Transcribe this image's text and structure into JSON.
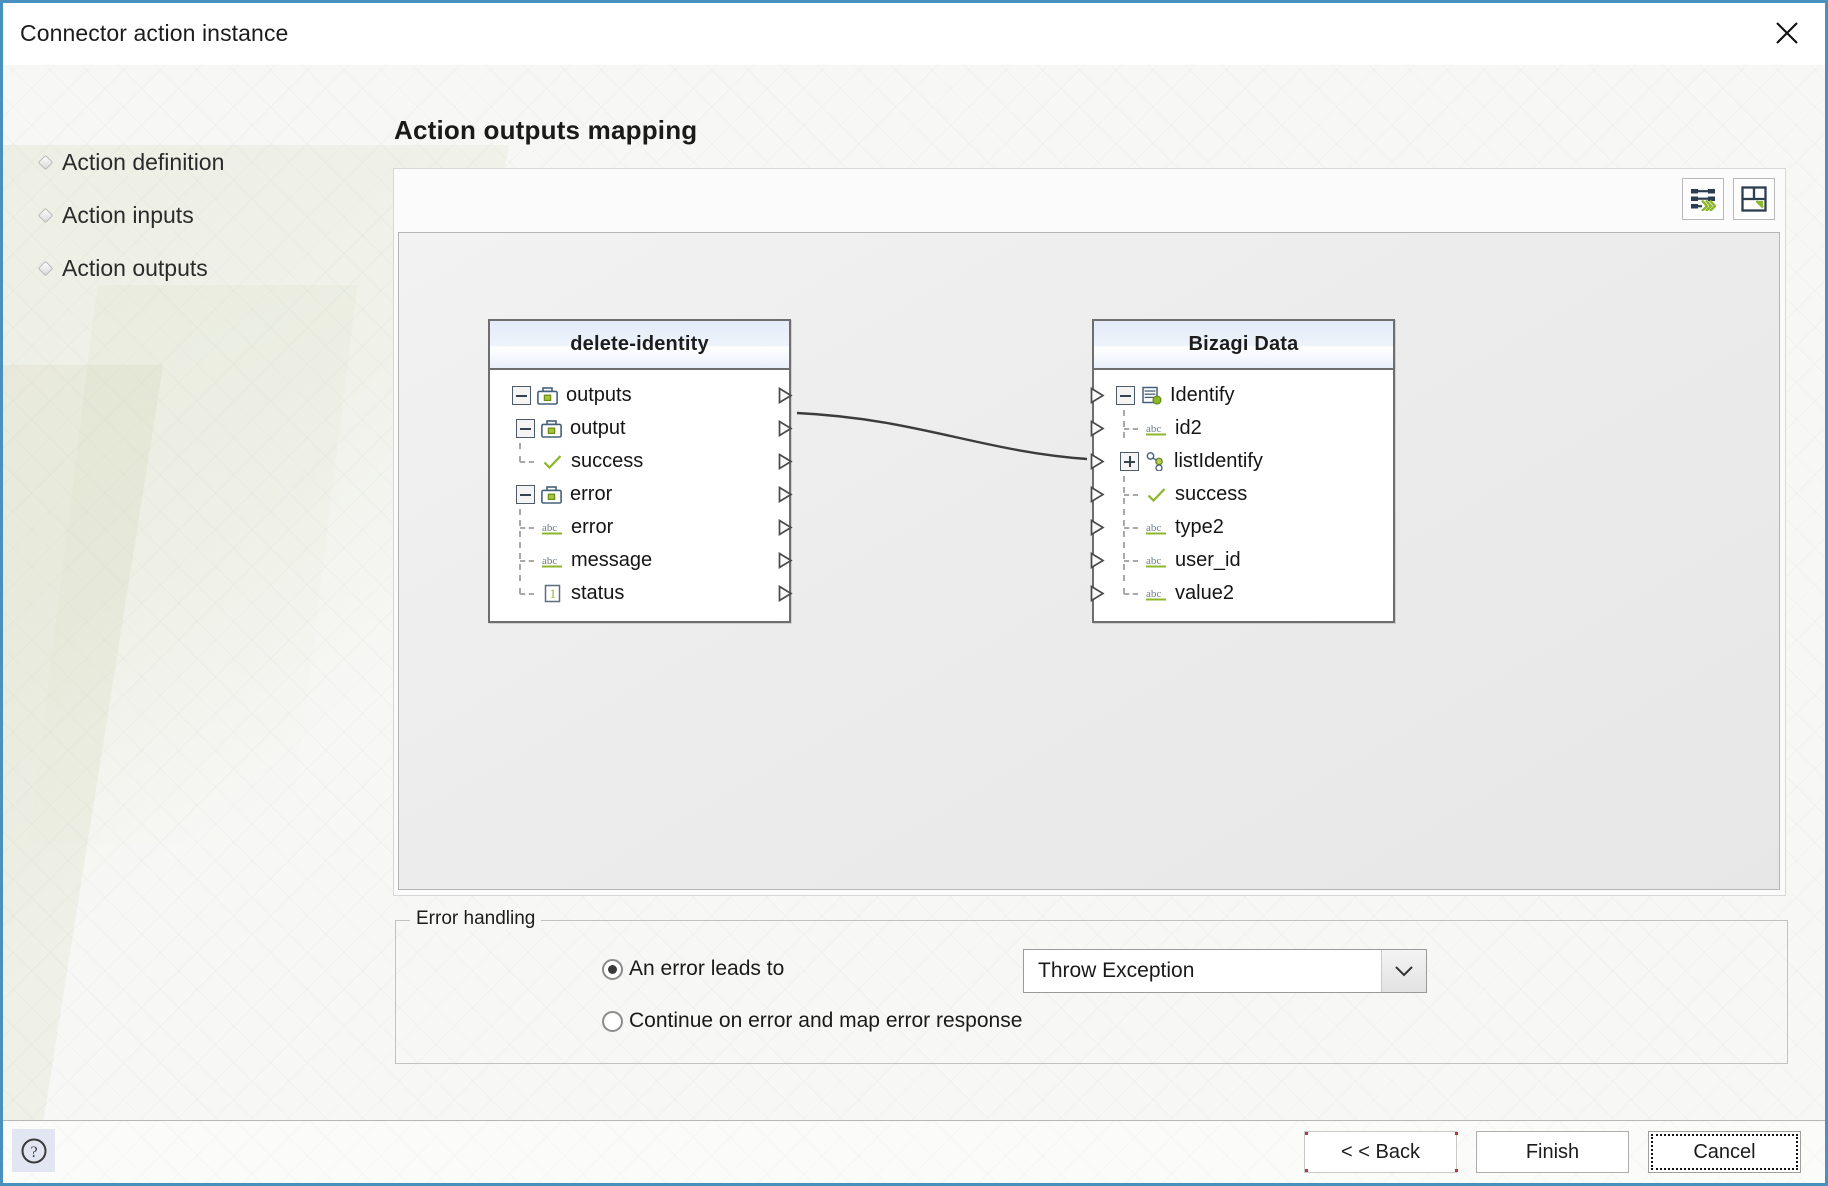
{
  "window": {
    "title": "Connector action instance",
    "close_icon": "close-icon"
  },
  "sidebar": {
    "items": [
      {
        "label": "Action definition"
      },
      {
        "label": "Action inputs"
      },
      {
        "label": "Action outputs"
      }
    ]
  },
  "main": {
    "page_title": "Action outputs mapping",
    "toolbar": [
      {
        "name": "auto-map-button",
        "icon": "auto-map-icon",
        "accent": "#8cb72b"
      },
      {
        "name": "layout-export-button",
        "icon": "save-layout-icon",
        "accent": "#8cb72b"
      }
    ],
    "mapper": {
      "source_panel": {
        "title": "delete-identity",
        "rows": [
          {
            "label": "outputs",
            "icon": "briefcase-icon",
            "indent": 0,
            "expander": "minus",
            "guide": "none",
            "port": "right"
          },
          {
            "label": "output",
            "icon": "briefcase-icon",
            "indent": 1,
            "expander": "minus",
            "guide": "none",
            "port": "right"
          },
          {
            "label": "success",
            "icon": "check-icon",
            "indent": 2,
            "expander": "none",
            "guide": "ell",
            "port": "right"
          },
          {
            "label": "error",
            "icon": "briefcase-icon",
            "indent": 1,
            "expander": "minus",
            "guide": "none",
            "port": "right"
          },
          {
            "label": "error",
            "icon": "abc-icon",
            "indent": 2,
            "expander": "none",
            "guide": "tee",
            "port": "right"
          },
          {
            "label": "message",
            "icon": "abc-icon",
            "indent": 2,
            "expander": "none",
            "guide": "tee",
            "port": "right"
          },
          {
            "label": "status",
            "icon": "number-icon",
            "indent": 2,
            "expander": "none",
            "guide": "ell",
            "port": "right"
          }
        ]
      },
      "target_panel": {
        "title": "Bizagi Data",
        "rows": [
          {
            "label": "Identify",
            "icon": "entity-icon",
            "indent": 0,
            "expander": "minus",
            "guide": "none",
            "port": "left"
          },
          {
            "label": "id2",
            "icon": "abc-icon",
            "indent": 1,
            "expander": "none",
            "guide": "tee",
            "port": "left"
          },
          {
            "label": "listIdentify",
            "icon": "collection-icon",
            "indent": 1,
            "expander": "plus",
            "guide": "none",
            "port": "left"
          },
          {
            "label": "success",
            "icon": "check-icon",
            "indent": 1,
            "expander": "none",
            "guide": "tee",
            "port": "left"
          },
          {
            "label": "type2",
            "icon": "abc-icon",
            "indent": 1,
            "expander": "none",
            "guide": "tee",
            "port": "left"
          },
          {
            "label": "user_id",
            "icon": "abc-icon",
            "indent": 1,
            "expander": "none",
            "guide": "tee",
            "port": "left"
          },
          {
            "label": "value2",
            "icon": "abc-icon",
            "indent": 1,
            "expander": "none",
            "guide": "ell",
            "port": "left"
          }
        ]
      },
      "links": [
        {
          "from": "success",
          "to": "success"
        }
      ]
    },
    "error_handling": {
      "legend": "Error handling",
      "option_leads_to": "An error leads to",
      "option_leads_to_selected": true,
      "option_continue": "Continue on error and map error response",
      "option_continue_selected": false,
      "select_value": "Throw Exception"
    }
  },
  "footer": {
    "help_icon": "help-icon",
    "buttons": [
      {
        "label": "< < Back",
        "state": "default-focus"
      },
      {
        "label": "Finish",
        "state": "normal"
      },
      {
        "label": "Cancel",
        "state": "keyboard-focus"
      }
    ]
  }
}
